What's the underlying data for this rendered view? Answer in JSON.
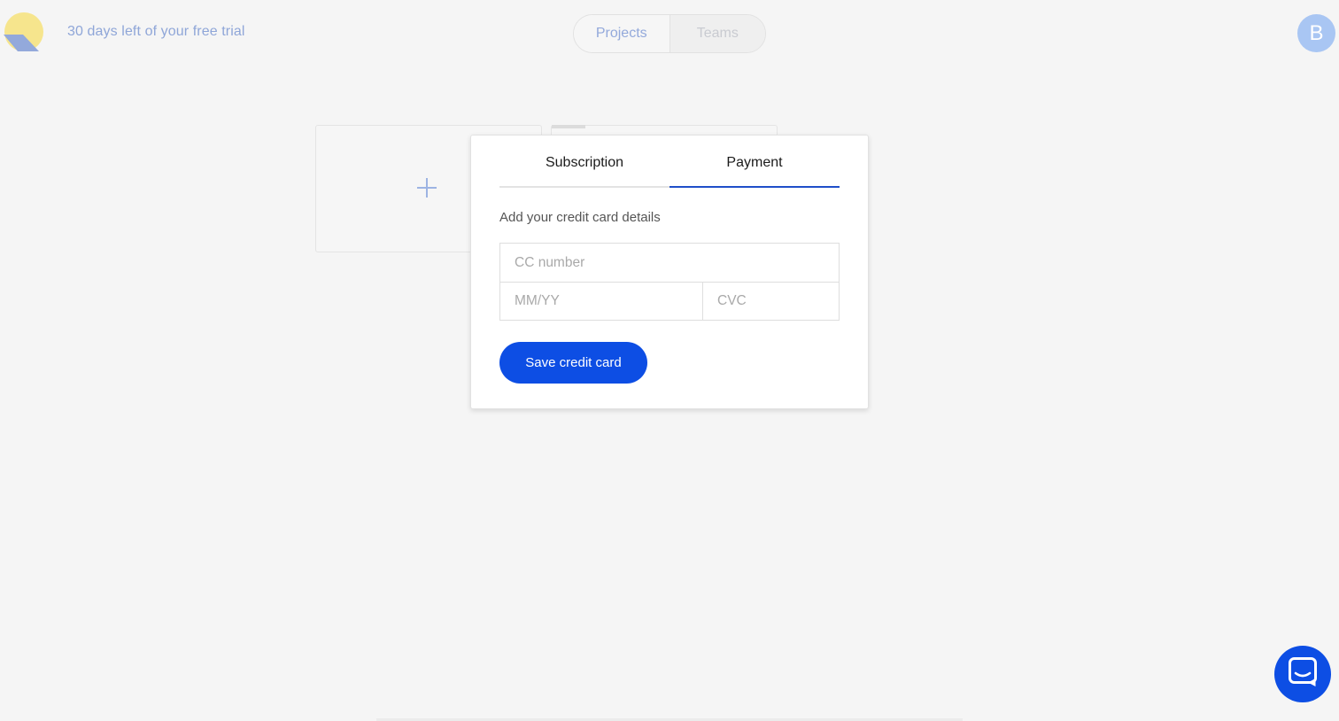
{
  "header": {
    "logo_icon": "app-logo-icon",
    "trial_text": "30 days left of your free trial",
    "nav": {
      "projects_label": "Projects",
      "teams_label": "Teams",
      "active": "Projects"
    },
    "avatar_initial": "B"
  },
  "workspace": {
    "new_project_icon": "plus-icon"
  },
  "modal": {
    "tabs": [
      {
        "label": "Subscription",
        "active": false
      },
      {
        "label": "Payment",
        "active": true
      }
    ],
    "heading": "Add your credit card details",
    "fields": {
      "cc_number_placeholder": "CC number",
      "expiry_placeholder": "MM/YY",
      "cvc_placeholder": "CVC"
    },
    "save_label": "Save credit card"
  },
  "chat": {
    "icon": "chat-icon"
  },
  "colors": {
    "accent": "#0d4ee4",
    "tab_underline": "#1f4fc9",
    "avatar_bg": "#a9c6f3",
    "trial_text": "#8fa6d8",
    "background": "#f5f5f5"
  }
}
